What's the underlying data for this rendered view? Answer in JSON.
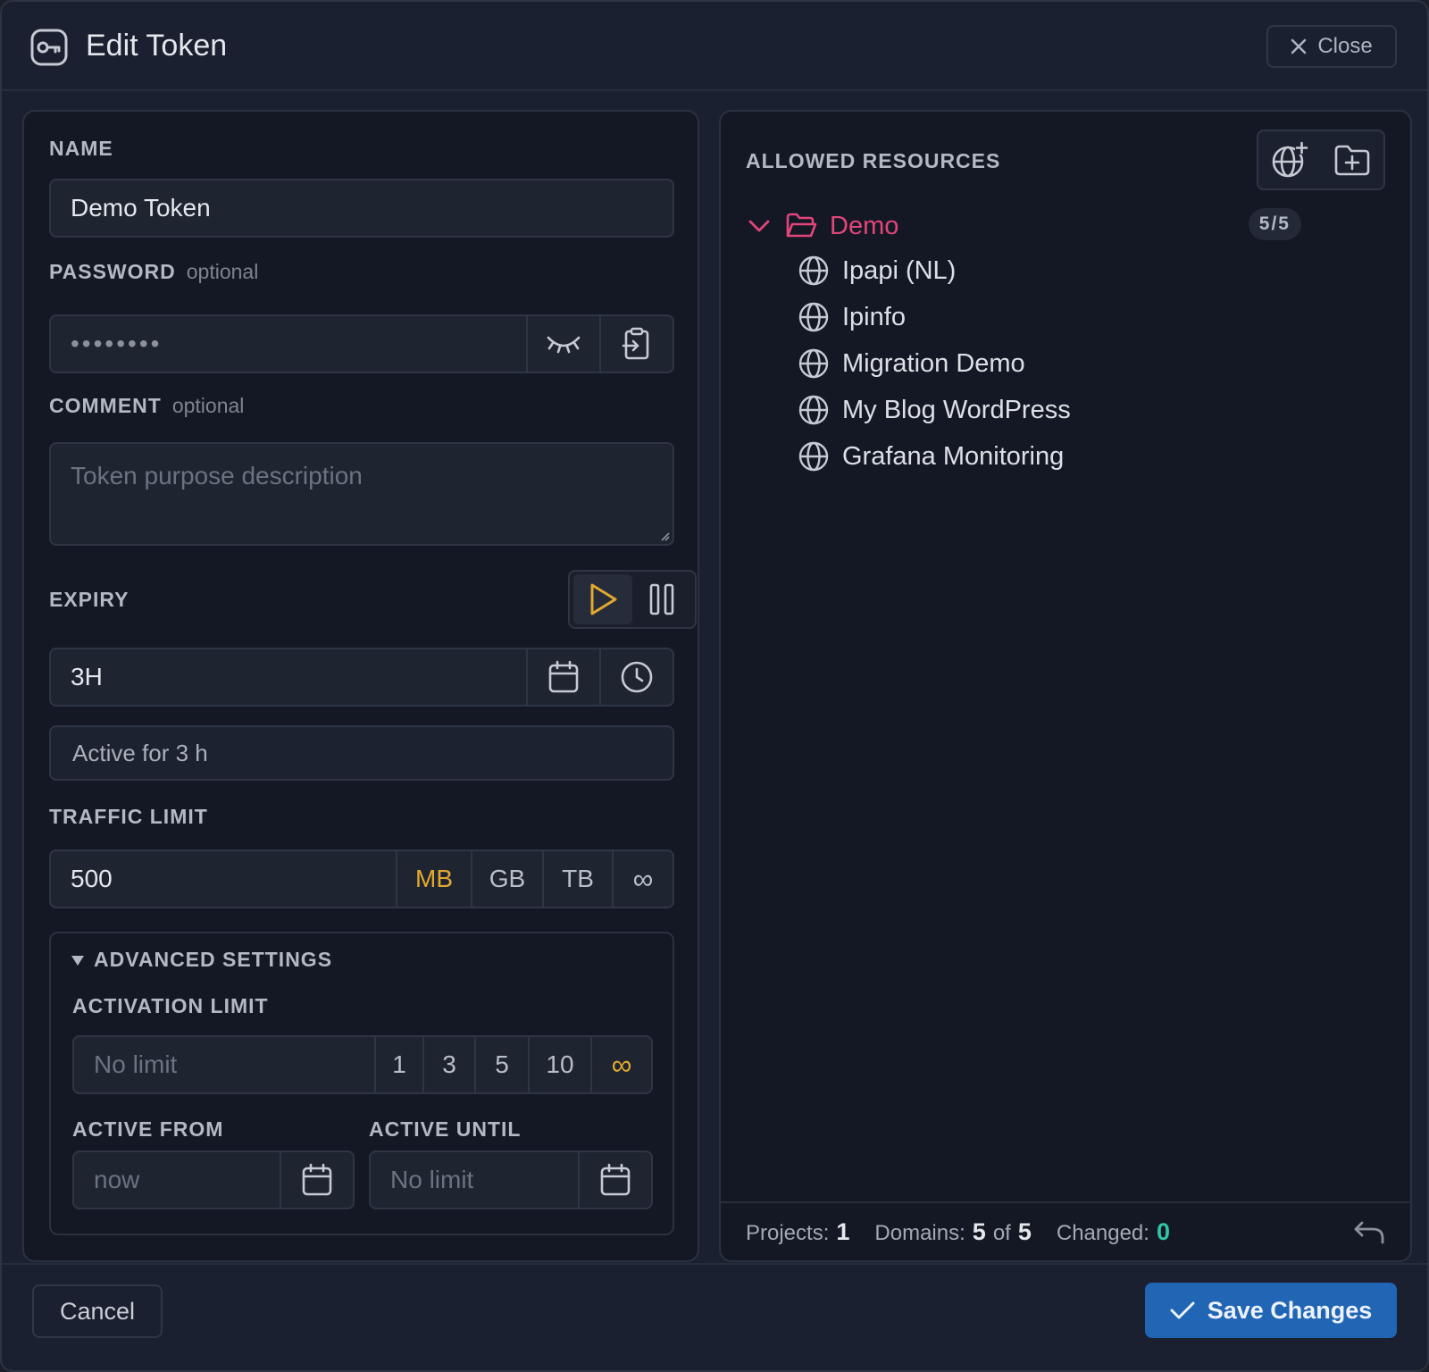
{
  "header": {
    "title": "Edit Token",
    "close_label": "Close"
  },
  "form": {
    "name_label": "NAME",
    "name_value": "Demo Token",
    "password_label": "PASSWORD",
    "password_optional": "optional",
    "password_value": "••••••••",
    "comment_label": "COMMENT",
    "comment_optional": "optional",
    "comment_placeholder": "Token purpose description",
    "expiry_label": "EXPIRY",
    "expiry_value": "3H",
    "expiry_status": "Active for 3 h",
    "traffic_label": "TRAFFIC LIMIT",
    "traffic_value": "500",
    "traffic_units": [
      "MB",
      "GB",
      "TB",
      "∞"
    ],
    "traffic_selected_unit": "MB"
  },
  "advanced": {
    "title": "ADVANCED SETTINGS",
    "activation_label": "ACTIVATION LIMIT",
    "activation_placeholder": "No limit",
    "activation_options": [
      "1",
      "3",
      "5",
      "10",
      "∞"
    ],
    "active_from_label": "ACTIVE FROM",
    "active_from_placeholder": "now",
    "active_until_label": "ACTIVE UNTIL",
    "active_until_placeholder": "No limit"
  },
  "resources": {
    "title": "ALLOWED RESOURCES",
    "project": {
      "name": "Demo",
      "count": "5/5"
    },
    "domains": [
      "Ipapi (NL)",
      "Ipinfo",
      "Migration Demo",
      "My Blog WordPress",
      "Grafana Monitoring"
    ]
  },
  "stats": {
    "projects_label": "Projects:",
    "projects_value": "1",
    "domains_label": "Domains:",
    "domains_value": "5",
    "domains_of": "of",
    "domains_total": "5",
    "changed_label": "Changed:",
    "changed_value": "0"
  },
  "actions": {
    "cancel_label": "Cancel",
    "save_label": "Save Changes"
  },
  "colors": {
    "accent_amber": "#e2a92e",
    "accent_pink": "#e2457a",
    "accent_teal": "#30c6a4",
    "primary_blue": "#2165b5"
  }
}
